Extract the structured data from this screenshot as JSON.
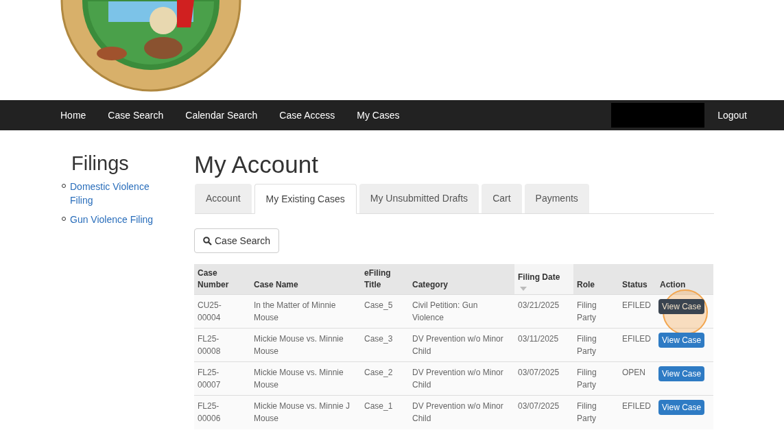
{
  "nav": {
    "items": [
      "Home",
      "Case Search",
      "Calendar Search",
      "Case Access",
      "My Cases"
    ],
    "logout": "Logout"
  },
  "sidebar": {
    "title": "Filings",
    "links": [
      "Domestic Violence Filing",
      "Gun Violence Filing"
    ]
  },
  "page_title": "My Account",
  "tabs": [
    {
      "label": "Account",
      "selected": false
    },
    {
      "label": "My Existing Cases",
      "selected": true
    },
    {
      "label": "My Unsubmitted Drafts",
      "selected": false
    },
    {
      "label": "Cart",
      "selected": false
    },
    {
      "label": "Payments",
      "selected": false
    }
  ],
  "search_button": "Case Search",
  "table": {
    "columns": [
      {
        "label": "Case Number",
        "sorted": false
      },
      {
        "label": "Case Name",
        "sorted": false
      },
      {
        "label": "eFiling Title",
        "sorted": false
      },
      {
        "label": "Category",
        "sorted": false
      },
      {
        "label": "Filing Date",
        "sorted": true
      },
      {
        "label": "Role",
        "sorted": false
      },
      {
        "label": "Status",
        "sorted": false
      },
      {
        "label": "Action",
        "sorted": false
      }
    ],
    "rows": [
      {
        "cells": [
          "CU25-00004",
          "In the Matter of Minnie Mouse",
          "Case_5",
          "Civil Petition: Gun Violence",
          "03/21/2025",
          "Filing Party",
          "EFILED"
        ],
        "action": "View Case",
        "highlighted": true
      },
      {
        "cells": [
          "FL25-00008",
          "Mickie Mouse vs. Minnie Mouse",
          "Case_3",
          "DV Prevention w/o Minor Child",
          "03/11/2025",
          "Filing Party",
          "EFILED"
        ],
        "action": "View Case",
        "highlighted": false
      },
      {
        "cells": [
          "FL25-00007",
          "Mickie Mouse vs. Minnie Mouse",
          "Case_2",
          "DV Prevention w/o Minor Child",
          "03/07/2025",
          "Filing Party",
          "OPEN"
        ],
        "action": "View Case",
        "highlighted": false
      },
      {
        "cells": [
          "FL25-00006",
          "Mickie Mouse vs. Minnie J Mouse",
          "Case_1",
          "DV Prevention w/o Minor Child",
          "03/07/2025",
          "Filing Party",
          "EFILED"
        ],
        "action": "View Case",
        "highlighted": false
      }
    ]
  }
}
